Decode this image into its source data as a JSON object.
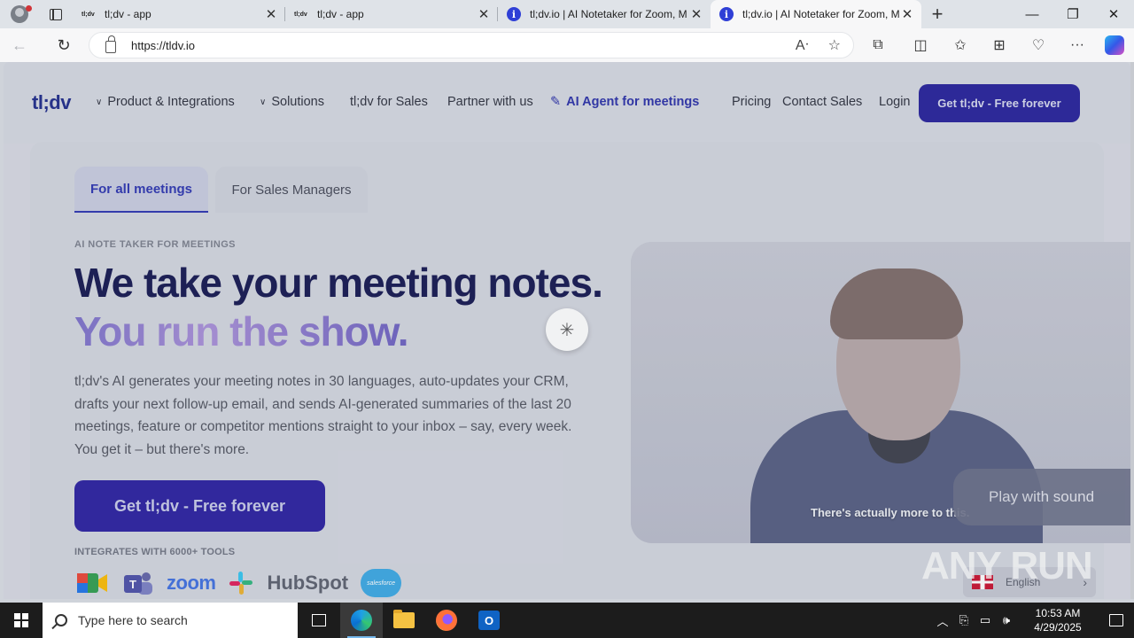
{
  "browser": {
    "tabs": [
      {
        "favicon": "tl;dv",
        "label": "tl;dv - app"
      },
      {
        "favicon": "tl;dv",
        "label": "tl;dv - app"
      },
      {
        "favicon": "info-icon",
        "label": "tl;dv.io | AI Notetaker for Zoom, M"
      },
      {
        "favicon": "info-icon",
        "label": "tl;dv.io | AI Notetaker for Zoom, M"
      }
    ],
    "active_tab_index": 3,
    "url": "https://tldv.io"
  },
  "site": {
    "logo": "tl;dv",
    "nav": {
      "product": "Product & Integrations",
      "solutions": "Solutions",
      "sales": "tl;dv for Sales",
      "partner": "Partner with us",
      "agent": "AI Agent for meetings",
      "pricing": "Pricing",
      "contact": "Contact Sales",
      "login": "Login",
      "cta": "Get tl;dv - Free forever"
    },
    "tabs": {
      "all": "For all meetings",
      "managers": "For Sales Managers"
    },
    "hero": {
      "eyebrow": "AI NOTE TAKER FOR MEETINGS",
      "headline_part1": "We take your meeting notes.",
      "headline_part2": "You run the show.",
      "body": "tl;dv's AI generates your meeting notes in 30 languages, auto-updates your CRM, drafts your next follow-up email, and sends AI-generated summaries of the last 20 meetings, feature or competitor mentions straight to your inbox – say, every week. You get it – but there's more.",
      "cta": "Get tl;dv - Free forever",
      "integrations_label": "INTEGRATES WITH 6000+ TOOLS",
      "integrations": [
        "zoom",
        "HubSpot",
        "salesforce"
      ]
    },
    "video": {
      "caption": "There's actually more to this.",
      "play_sound": "Play with sound"
    },
    "language": "English"
  },
  "watermark": "ANY RUN",
  "taskbar": {
    "search_placeholder": "Type here to search",
    "time": "10:53 AM",
    "date": "4/29/2025"
  },
  "colors": {
    "brand": "#25209a",
    "headline": "#141650"
  }
}
